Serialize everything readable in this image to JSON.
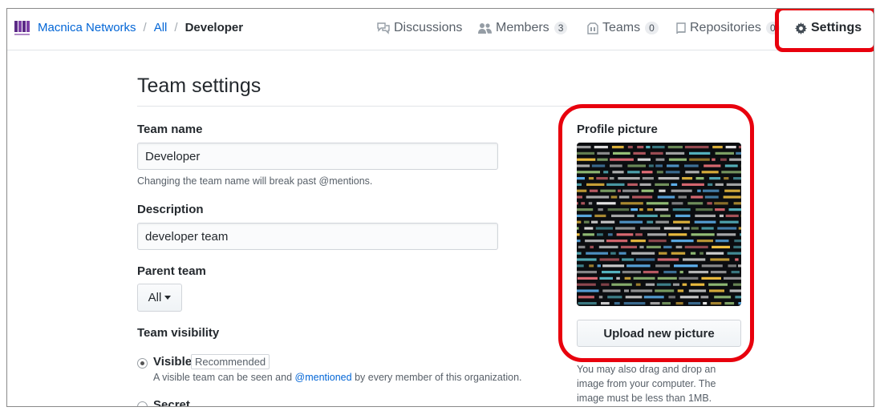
{
  "breadcrumb": {
    "org": "Macnica Networks",
    "all": "All",
    "separator": "/",
    "team": "Developer"
  },
  "nav": {
    "discussions": "Discussions",
    "members": "Members",
    "members_count": "3",
    "teams": "Teams",
    "teams_count": "0",
    "repositories": "Repositories",
    "repositories_count": "0",
    "settings": "Settings"
  },
  "page": {
    "title": "Team settings"
  },
  "form": {
    "team_name_label": "Team name",
    "team_name_value": "Developer",
    "team_name_note": "Changing the team name will break past @mentions.",
    "description_label": "Description",
    "description_value": "developer team",
    "parent_team_label": "Parent team",
    "parent_team_value": "All",
    "visibility_label": "Team visibility",
    "visible_label": "Visible",
    "recommended_badge": "Recommended",
    "visible_note_pre": "A visible team can be seen and ",
    "visible_note_link": "@mentioned",
    "visible_note_post": " by every member of this organization.",
    "secret_label": "Secret"
  },
  "profile_picture": {
    "label": "Profile picture",
    "upload_button": "Upload new picture",
    "note": "You may also drag and drop an image from your computer. The image must be less than 1MB."
  },
  "colors": {
    "link": "#0366d6",
    "highlight": "#e8000d",
    "text": "#24292e",
    "muted": "#586069"
  }
}
